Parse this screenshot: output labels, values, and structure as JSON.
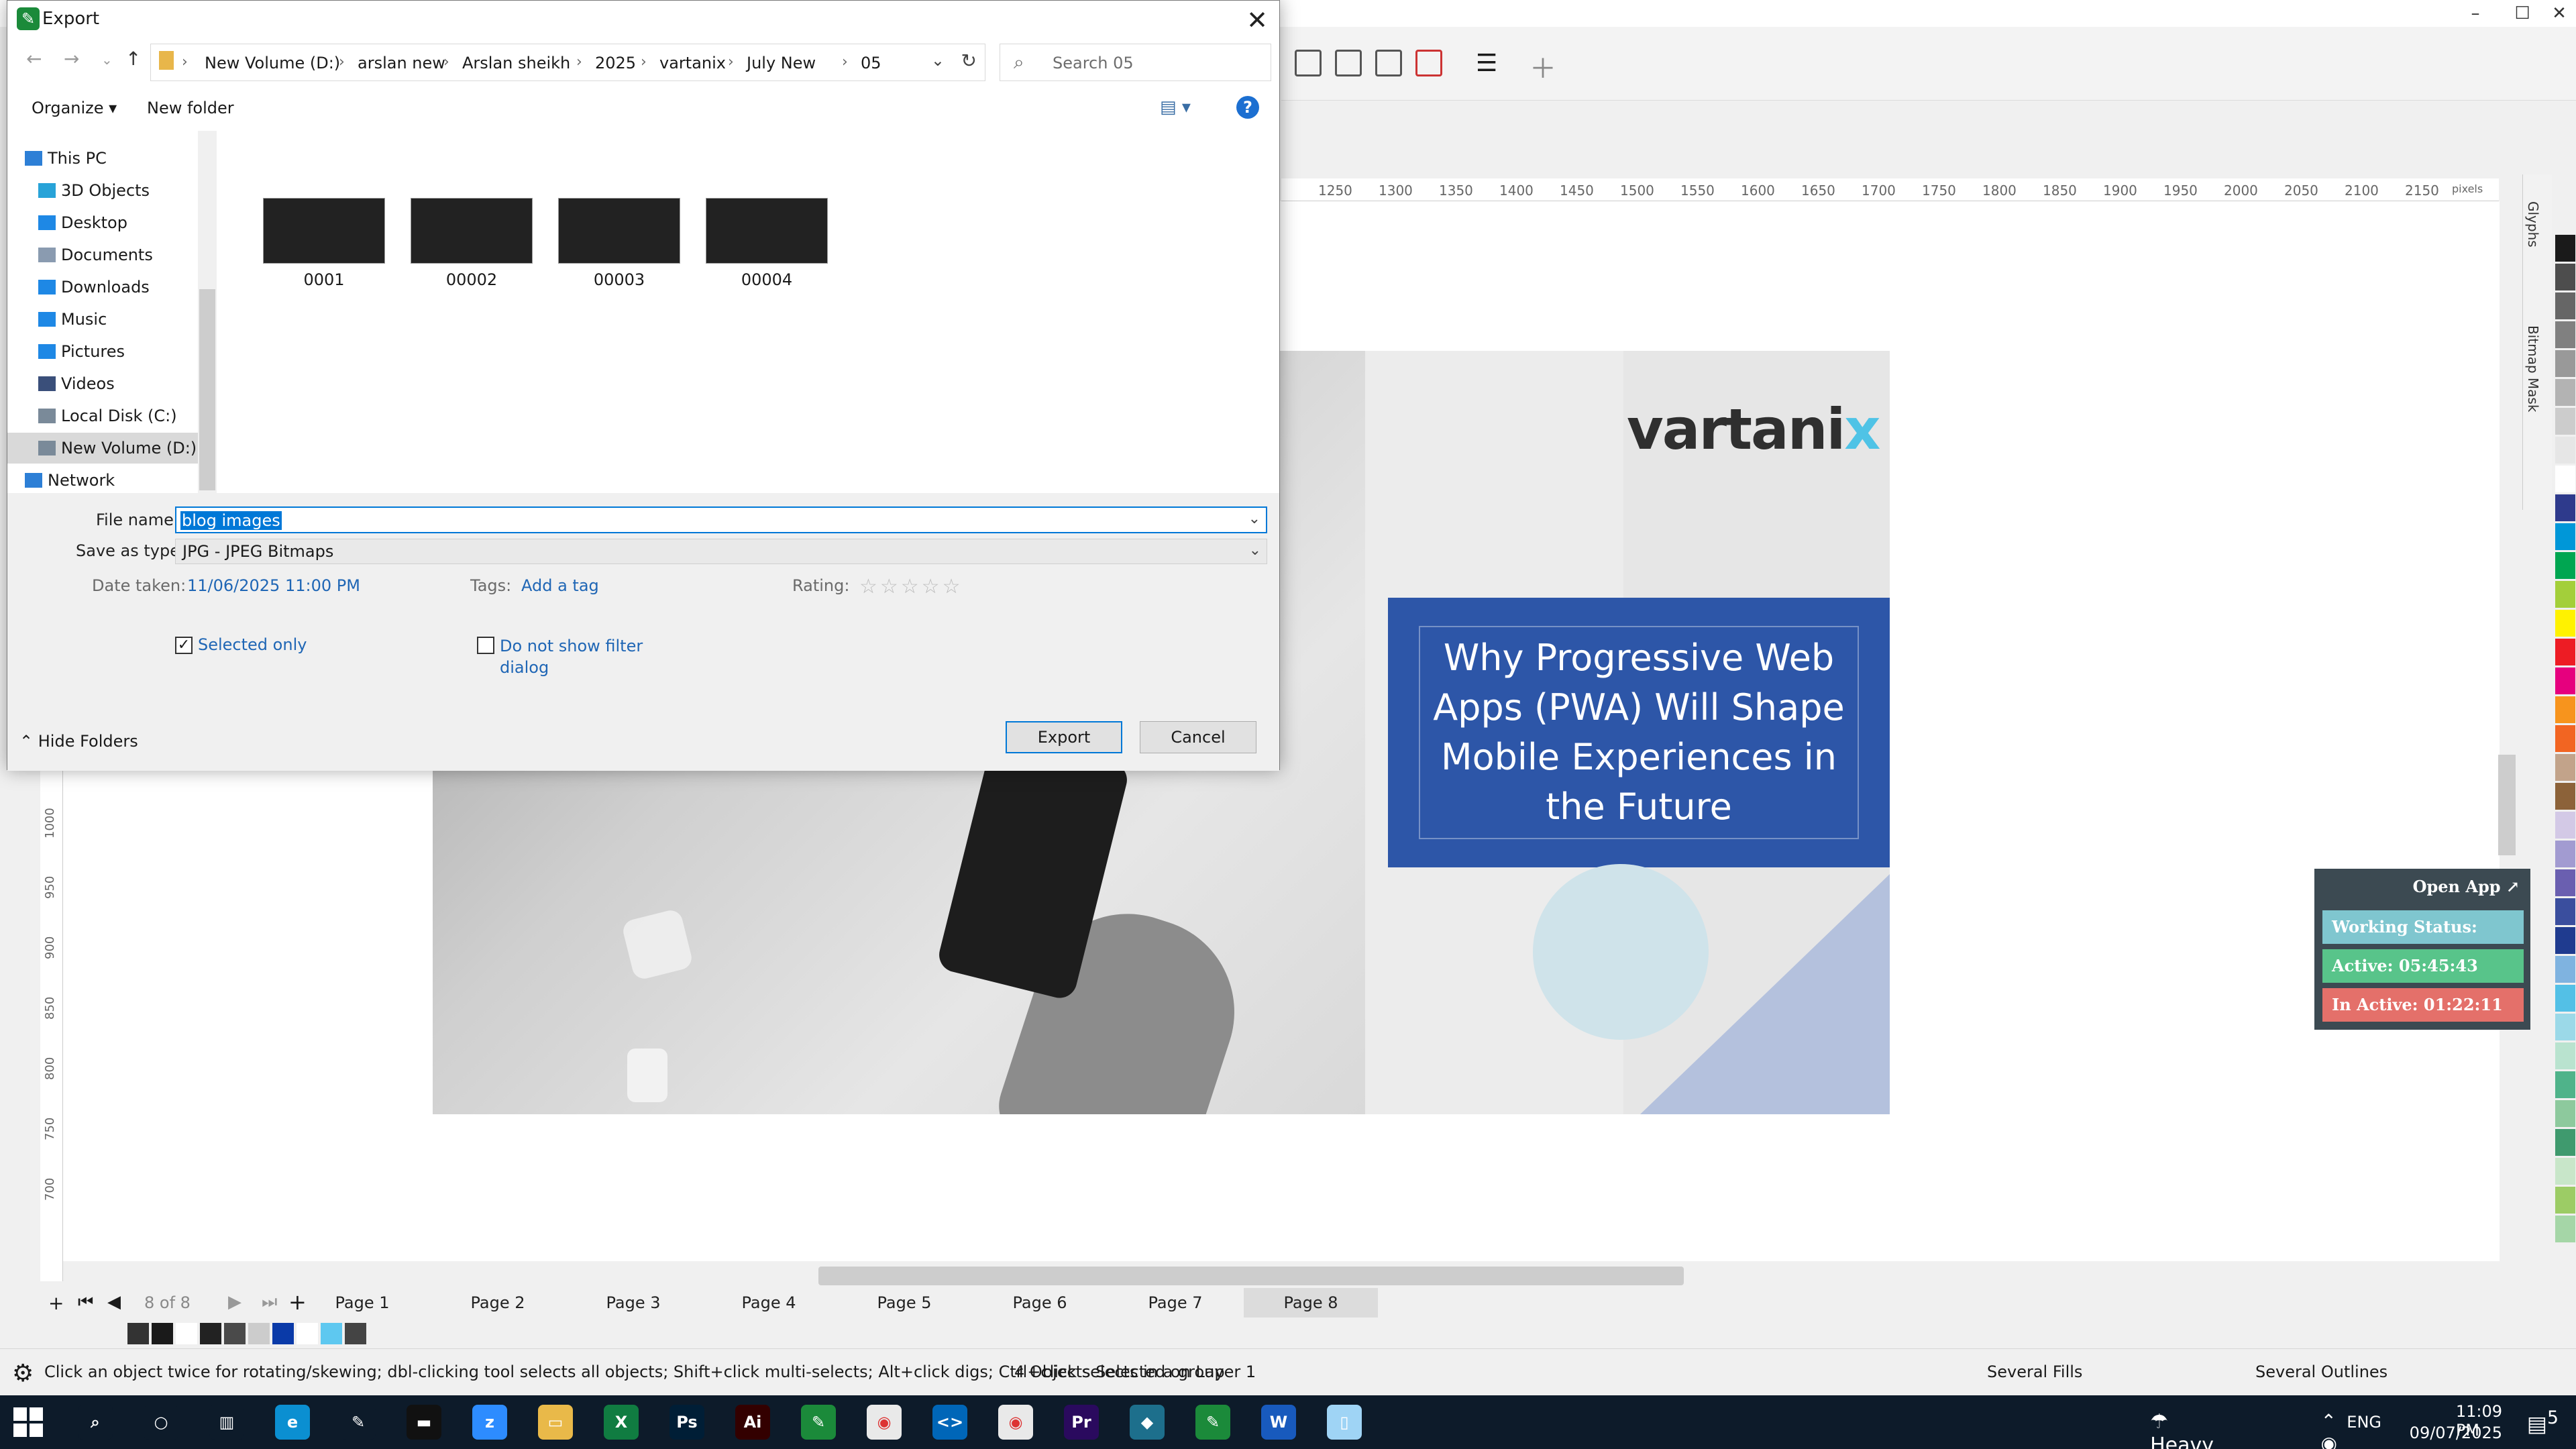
{
  "app": {
    "window_controls": [
      "–",
      "☐",
      "✕"
    ],
    "ruler_top_ticks": [
      "1250",
      "1300",
      "1350",
      "1400",
      "1450",
      "1500",
      "1550",
      "1600",
      "1650",
      "1700",
      "1750",
      "1800",
      "1850",
      "1900",
      "1950",
      "2000",
      "2050",
      "2100",
      "2150"
    ],
    "ruler_unit": "pixels",
    "ruler_left_ticks": [
      "1000",
      "950",
      "900",
      "850",
      "800",
      "750",
      "700"
    ],
    "dock_tabs": [
      "Glyphs",
      "Bitmap Mask"
    ],
    "artwork": {
      "brand_logo_main": "vartani",
      "brand_logo_accent": "x",
      "headline": "Why Progressive Web Apps (PWA) Will Shape Mobile Experiences in the Future",
      "colors": {
        "headline_bg": "#2d56a8",
        "accent": "#4fc3e6",
        "triangle": "#b4c1dd",
        "circle": "#cfe3ea"
      }
    },
    "page_count": "8 of 8",
    "pages": [
      "Page 1",
      "Page 2",
      "Page 3",
      "Page 4",
      "Page 5",
      "Page 6",
      "Page 7",
      "Page 8"
    ],
    "active_page": "Page 8",
    "status": {
      "hint": "Click an object twice for rotating/skewing; dbl-clicking tool selects all objects; Shift+click multi-selects; Alt+click digs; Ctrl+click selects in a group",
      "selection": "4 Objects Selected on Layer 1",
      "fills": "Several Fills",
      "outlines": "Several Outlines"
    },
    "swatches": [
      "#333333",
      "#1a1a1a",
      "#ffffff",
      "#222222",
      "#4a4a4a",
      "#cccccc",
      "#0a3aa8",
      "#ffffff",
      "#5ec8f0",
      "#444444"
    ],
    "palette": [
      "#1a1a1a",
      "#4d4d4d",
      "#666666",
      "#808080",
      "#999999",
      "#b3b3b3",
      "#cccccc",
      "#e6e6e6",
      "#ffffff",
      "#2e3a8c",
      "#0097d8",
      "#00a651",
      "#a3cf3a",
      "#fff200",
      "#ed1c24",
      "#e6007e",
      "#f7941d",
      "#f26522",
      "#c2a38a",
      "#8c6239",
      "#d3c9e6",
      "#a29bd1",
      "#6a5fb0",
      "#3a4e9e",
      "#1f3b8f",
      "#7fb3e0",
      "#53c0e6",
      "#9bd9e8",
      "#b9e3cf",
      "#4fb38a",
      "#8dc99d",
      "#3f9a6e",
      "#c8e6c9",
      "#9ccc65",
      "#a5d6a7"
    ]
  },
  "tracker": {
    "open_label": "Open App ↗",
    "working_status": "Working Status: Active",
    "active": "Active: 05:45:43",
    "inactive": "In Active: 01:22:11"
  },
  "dialog": {
    "title": "Export",
    "breadcrumbs": [
      "New Volume (D:)",
      "arslan new",
      "Arslan sheikh",
      "2025",
      "vartanix",
      "July New",
      "05"
    ],
    "search_placeholder": "Search 05",
    "organize": "Organize ▾",
    "new_folder": "New folder",
    "nav_items": [
      {
        "label": "This PC",
        "color": "#2d7fd6"
      },
      {
        "label": "3D Objects",
        "color": "#28a3d8"
      },
      {
        "label": "Desktop",
        "color": "#1e88e5"
      },
      {
        "label": "Documents",
        "color": "#8a9bb0"
      },
      {
        "label": "Downloads",
        "color": "#1e88e5"
      },
      {
        "label": "Music",
        "color": "#1e88e5"
      },
      {
        "label": "Pictures",
        "color": "#1e88e5"
      },
      {
        "label": "Videos",
        "color": "#3a4f7a"
      },
      {
        "label": "Local Disk (C:)",
        "color": "#7a8a99"
      },
      {
        "label": "New Volume (D:)",
        "color": "#7a8a99"
      },
      {
        "label": "Network",
        "color": "#2d7fd6"
      }
    ],
    "selected_nav": "New Volume (D:)",
    "files": [
      "0001",
      "00002",
      "00003",
      "00004"
    ],
    "file_name_label": "File name:",
    "file_name_value": "blog images",
    "save_type_label": "Save as type:",
    "save_type_value": "JPG - JPEG Bitmaps",
    "date_taken_label": "Date taken:",
    "date_taken_value": "11/06/2025 11:00 PM",
    "tags_label": "Tags:",
    "tags_value": "Add a tag",
    "rating_label": "Rating:",
    "rating_stars": "☆☆☆☆☆",
    "selected_only_label": "Selected only",
    "selected_only_checked": true,
    "no_filter_label": "Do not show filter dialog",
    "hide_folders": "Hide Folders",
    "export_button": "Export",
    "cancel_button": "Cancel"
  },
  "taskbar": {
    "apps": [
      "Search",
      "Cortana",
      "Task View",
      "Edge",
      "Pen",
      "Terminal",
      "Zoom",
      "File Explorer",
      "Excel",
      "Photoshop",
      "Illustrator",
      "CorelDRAW",
      "Chrome",
      "VS Code",
      "Chrome Profile",
      "Premiere Pro",
      "App",
      "CorelDRAW Active",
      "Word",
      "Notepad"
    ],
    "weather": "Heavy rain soon",
    "language": "ENG",
    "time": "11:09 PM",
    "date": "09/07/2025",
    "notifications": "5"
  }
}
